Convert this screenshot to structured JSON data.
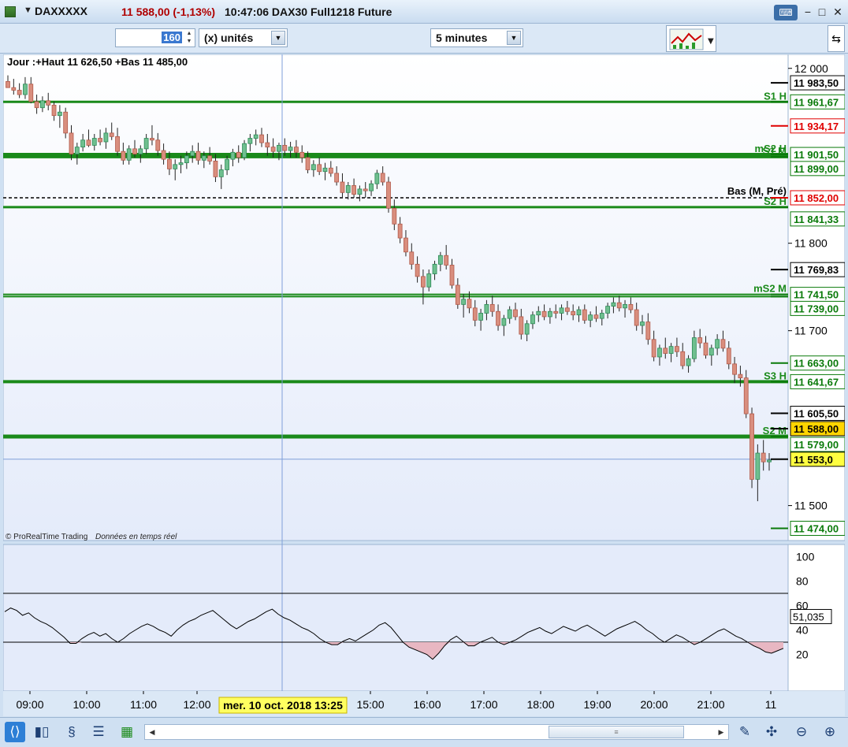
{
  "window": {
    "symbol": "DAXXXXX",
    "price_change": "11 588,00 (-1,13%)",
    "time_instrument": "10:47:06 DAX30 Full1218 Future",
    "keyboard_icon": "keyboard-icon"
  },
  "toolbar": {
    "units_value": "160",
    "units_label": "(x) unités",
    "timeframe": "5 minutes"
  },
  "chart": {
    "header": "Jour :+Haut 11 626,50 +Bas 11 485,00",
    "copyright": "© ProRealTime Trading",
    "realtime": "Données en temps réel",
    "price_ticks": [
      "12 000",
      "11 800",
      "11 700",
      "11 500"
    ],
    "rsi_ticks": [
      "100",
      "80",
      "60",
      "40",
      "20"
    ],
    "rsi_value": "51,035",
    "time_ticks": [
      "09:00",
      "10:00",
      "11:00",
      "12:00",
      "15:00",
      "16:00",
      "17:00",
      "18:00",
      "19:00",
      "20:00",
      "21:00",
      "11"
    ],
    "cursor_date": "mer. 10 oct. 2018 13:25",
    "level_labels": [
      {
        "text": "11 983,50",
        "color": "#000000",
        "bg": "#ffffff"
      },
      {
        "text": "11 961,67",
        "color": "#0a7a0a",
        "bg": "#ffffff"
      },
      {
        "text": "11 934,17",
        "color": "#e00000",
        "bg": "#ffffff"
      },
      {
        "text": "11 901,50",
        "color": "#0a7a0a",
        "bg": "#ffffff"
      },
      {
        "text": "11 899,00",
        "color": "#0a7a0a",
        "bg": "#ffffff"
      },
      {
        "text": "11 852,00",
        "color": "#e00000",
        "bg": "#ffffff"
      },
      {
        "text": "11 841,33",
        "color": "#0a7a0a",
        "bg": "#ffffff"
      },
      {
        "text": "11 769,83",
        "color": "#000000",
        "bg": "#ffffff"
      },
      {
        "text": "11 741,50",
        "color": "#0a7a0a",
        "bg": "#ffffff"
      },
      {
        "text": "11 739,00",
        "color": "#0a7a0a",
        "bg": "#ffffff"
      },
      {
        "text": "11 663,00",
        "color": "#0a7a0a",
        "bg": "#ffffff"
      },
      {
        "text": "11 641,67",
        "color": "#0a7a0a",
        "bg": "#ffffff"
      },
      {
        "text": "11 605,50",
        "color": "#000000",
        "bg": "#ffffff"
      },
      {
        "text": "11 588,00",
        "color": "#000000",
        "bg": "#ffd500"
      },
      {
        "text": "11 579,00",
        "color": "#0a7a0a",
        "bg": "#ffffff"
      },
      {
        "text": "11 553,0",
        "color": "#000000",
        "bg": "#ffff40"
      },
      {
        "text": "11 474,00",
        "color": "#0a7a0a",
        "bg": "#ffffff"
      }
    ],
    "line_tags": [
      "S1 H",
      "mS2 H",
      "S1 M",
      "Bas (M, Pré)",
      "S2 H",
      "mS2 M",
      "S3 H",
      "S2 M"
    ]
  },
  "chart_data": {
    "type": "candlestick",
    "series": [
      {
        "values": [
          [
            11985,
            11992,
            11980,
            11978
          ],
          [
            11978,
            11988,
            11970,
            11975
          ],
          [
            11975,
            11983,
            11966,
            11970
          ],
          [
            11970,
            11990,
            11965,
            11982
          ],
          [
            11982,
            11990,
            11960,
            11962
          ],
          [
            11962,
            11970,
            11948,
            11955
          ],
          [
            11955,
            11968,
            11950,
            11963
          ],
          [
            11963,
            11972,
            11952,
            11958
          ],
          [
            11958,
            11962,
            11940,
            11946
          ],
          [
            11946,
            11958,
            11932,
            11950
          ],
          [
            11950,
            11955,
            11920,
            11926
          ],
          [
            11926,
            11935,
            11895,
            11902
          ],
          [
            11902,
            11915,
            11890,
            11910
          ],
          [
            11910,
            11925,
            11905,
            11918
          ],
          [
            11918,
            11930,
            11910,
            11912
          ],
          [
            11912,
            11925,
            11906,
            11920
          ],
          [
            11920,
            11930,
            11912,
            11916
          ],
          [
            11916,
            11932,
            11908,
            11926
          ],
          [
            11926,
            11938,
            11918,
            11922
          ],
          [
            11922,
            11932,
            11900,
            11905
          ],
          [
            11905,
            11915,
            11890,
            11895
          ],
          [
            11895,
            11912,
            11890,
            11908
          ],
          [
            11908,
            11918,
            11898,
            11902
          ],
          [
            11902,
            11912,
            11892,
            11908
          ],
          [
            11908,
            11925,
            11902,
            11920
          ],
          [
            11920,
            11935,
            11912,
            11918
          ],
          [
            11918,
            11926,
            11900,
            11906
          ],
          [
            11906,
            11914,
            11890,
            11896
          ],
          [
            11896,
            11905,
            11878,
            11885
          ],
          [
            11885,
            11896,
            11872,
            11890
          ],
          [
            11890,
            11900,
            11880,
            11892
          ],
          [
            11892,
            11905,
            11885,
            11900
          ],
          [
            11900,
            11912,
            11892,
            11905
          ],
          [
            11905,
            11915,
            11890,
            11895
          ],
          [
            11895,
            11905,
            11886,
            11900
          ],
          [
            11900,
            11910,
            11890,
            11894
          ],
          [
            11894,
            11902,
            11870,
            11876
          ],
          [
            11876,
            11890,
            11862,
            11884
          ],
          [
            11884,
            11900,
            11878,
            11896
          ],
          [
            11896,
            11908,
            11888,
            11904
          ],
          [
            11904,
            11912,
            11892,
            11898
          ],
          [
            11898,
            11918,
            11895,
            11914
          ],
          [
            11914,
            11925,
            11905,
            11920
          ],
          [
            11920,
            11930,
            11912,
            11924
          ],
          [
            11924,
            11932,
            11910,
            11915
          ],
          [
            11915,
            11925,
            11900,
            11910
          ],
          [
            11910,
            11920,
            11898,
            11905
          ],
          [
            11905,
            11915,
            11895,
            11912
          ],
          [
            11912,
            11920,
            11900,
            11906
          ],
          [
            11906,
            11916,
            11898,
            11910
          ],
          [
            11910,
            11918,
            11898,
            11904
          ],
          [
            11904,
            11912,
            11892,
            11898
          ],
          [
            11898,
            11905,
            11880,
            11884
          ],
          [
            11884,
            11895,
            11876,
            11890
          ],
          [
            11890,
            11898,
            11878,
            11882
          ],
          [
            11882,
            11892,
            11872,
            11886
          ],
          [
            11886,
            11894,
            11876,
            11880
          ],
          [
            11880,
            11888,
            11866,
            11870
          ],
          [
            11870,
            11880,
            11852,
            11858
          ],
          [
            11858,
            11870,
            11850,
            11866
          ],
          [
            11866,
            11874,
            11852,
            11856
          ],
          [
            11856,
            11866,
            11848,
            11862
          ],
          [
            11862,
            11870,
            11852,
            11860
          ],
          [
            11860,
            11872,
            11854,
            11868
          ],
          [
            11868,
            11884,
            11862,
            11880
          ],
          [
            11880,
            11888,
            11866,
            11870
          ],
          [
            11870,
            11876,
            11835,
            11840
          ],
          [
            11840,
            11850,
            11815,
            11822
          ],
          [
            11822,
            11830,
            11800,
            11806
          ],
          [
            11806,
            11815,
            11785,
            11790
          ],
          [
            11790,
            11800,
            11770,
            11776
          ],
          [
            11776,
            11785,
            11755,
            11762
          ],
          [
            11762,
            11770,
            11730,
            11750
          ],
          [
            11750,
            11770,
            11745,
            11765
          ],
          [
            11765,
            11780,
            11758,
            11776
          ],
          [
            11776,
            11790,
            11768,
            11786
          ],
          [
            11786,
            11798,
            11770,
            11775
          ],
          [
            11775,
            11782,
            11748,
            11752
          ],
          [
            11752,
            11760,
            11725,
            11730
          ],
          [
            11730,
            11742,
            11715,
            11736
          ],
          [
            11736,
            11745,
            11720,
            11726
          ],
          [
            11726,
            11735,
            11705,
            11712
          ],
          [
            11712,
            11725,
            11700,
            11720
          ],
          [
            11720,
            11735,
            11712,
            11730
          ],
          [
            11730,
            11740,
            11716,
            11722
          ],
          [
            11722,
            11730,
            11700,
            11706
          ],
          [
            11706,
            11718,
            11694,
            11714
          ],
          [
            11714,
            11728,
            11708,
            11724
          ],
          [
            11724,
            11732,
            11712,
            11716
          ],
          [
            11716,
            11725,
            11690,
            11696
          ],
          [
            11696,
            11712,
            11688,
            11708
          ],
          [
            11708,
            11722,
            11702,
            11718
          ],
          [
            11718,
            11728,
            11710,
            11722
          ],
          [
            11722,
            11730,
            11712,
            11716
          ],
          [
            11716,
            11726,
            11708,
            11722
          ],
          [
            11722,
            11730,
            11714,
            11720
          ],
          [
            11720,
            11730,
            11712,
            11726
          ],
          [
            11726,
            11734,
            11718,
            11722
          ],
          [
            11722,
            11730,
            11712,
            11718
          ],
          [
            11718,
            11728,
            11710,
            11724
          ],
          [
            11724,
            11730,
            11708,
            11712
          ],
          [
            11712,
            11722,
            11704,
            11718
          ],
          [
            11718,
            11728,
            11710,
            11714
          ],
          [
            11714,
            11724,
            11706,
            11720
          ],
          [
            11720,
            11732,
            11714,
            11728
          ],
          [
            11728,
            11738,
            11720,
            11732
          ],
          [
            11732,
            11740,
            11722,
            11726
          ],
          [
            11726,
            11735,
            11715,
            11730
          ],
          [
            11730,
            11738,
            11720,
            11724
          ],
          [
            11724,
            11732,
            11700,
            11706
          ],
          [
            11706,
            11718,
            11696,
            11710
          ],
          [
            11710,
            11720,
            11684,
            11690
          ],
          [
            11690,
            11700,
            11665,
            11670
          ],
          [
            11670,
            11684,
            11660,
            11680
          ],
          [
            11680,
            11692,
            11668,
            11674
          ],
          [
            11674,
            11686,
            11664,
            11682
          ],
          [
            11682,
            11692,
            11670,
            11676
          ],
          [
            11676,
            11686,
            11656,
            11660
          ],
          [
            11660,
            11672,
            11652,
            11668
          ],
          [
            11668,
            11700,
            11664,
            11692
          ],
          [
            11692,
            11702,
            11680,
            11686
          ],
          [
            11686,
            11694,
            11668,
            11672
          ],
          [
            11672,
            11684,
            11660,
            11680
          ],
          [
            11680,
            11696,
            11672,
            11690
          ],
          [
            11690,
            11700,
            11676,
            11680
          ],
          [
            11680,
            11688,
            11656,
            11662
          ],
          [
            11662,
            11670,
            11640,
            11650
          ],
          [
            11650,
            11660,
            11636,
            11646
          ],
          [
            11646,
            11655,
            11600,
            11605
          ],
          [
            11605,
            11612,
            11520,
            11530
          ],
          [
            11530,
            11570,
            11505,
            11560
          ],
          [
            11560,
            11575,
            11540,
            11550
          ],
          [
            11550,
            11560,
            11540,
            11552
          ]
        ]
      }
    ],
    "rsi": [
      55,
      58,
      56,
      52,
      54,
      50,
      47,
      45,
      42,
      38,
      34,
      29,
      29,
      33,
      36,
      38,
      35,
      37,
      33,
      30,
      33,
      37,
      40,
      43,
      45,
      43,
      40,
      38,
      35,
      40,
      44,
      47,
      49,
      52,
      54,
      56,
      52,
      48,
      44,
      41,
      44,
      47,
      49,
      52,
      55,
      57,
      53,
      50,
      48,
      45,
      42,
      40,
      37,
      33,
      30,
      28,
      28,
      31,
      33,
      31,
      34,
      37,
      40,
      44,
      46,
      42,
      36,
      30,
      26,
      24,
      22,
      20,
      16,
      21,
      27,
      32,
      35,
      31,
      27,
      27,
      30,
      32,
      34,
      30,
      28,
      30,
      32,
      35,
      38,
      40,
      42,
      39,
      37,
      40,
      43,
      41,
      39,
      42,
      44,
      41,
      38,
      35,
      38,
      41,
      43,
      45,
      47,
      44,
      40,
      37,
      33,
      30,
      33,
      36,
      34,
      31,
      28,
      30,
      33,
      36,
      39,
      41,
      38,
      35,
      33,
      30,
      27,
      25,
      22,
      21,
      23,
      25
    ]
  }
}
